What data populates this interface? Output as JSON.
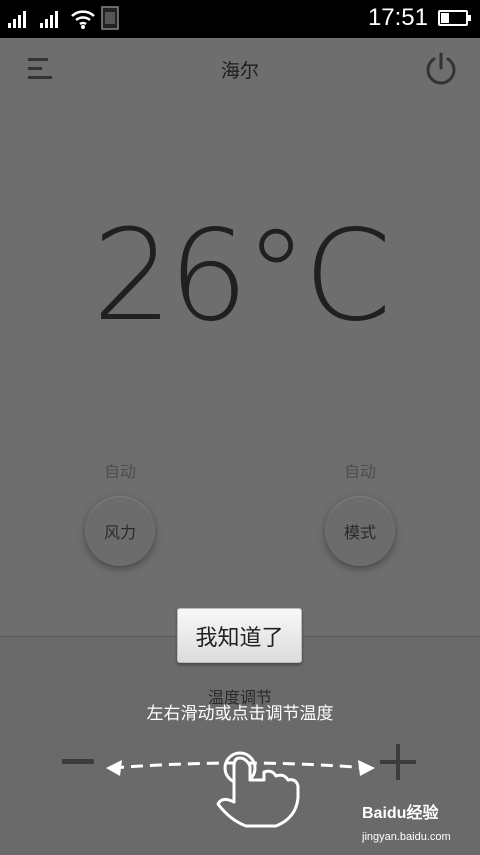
{
  "status_bar": {
    "time": "17:51",
    "battery_level": 0.35
  },
  "header": {
    "title": "海尔",
    "menu_icon": "menu-icon",
    "power_icon": "power-icon"
  },
  "main": {
    "temperature": "26°C",
    "fan": {
      "status": "自动",
      "label": "风力"
    },
    "mode": {
      "status": "自动",
      "label": "模式"
    }
  },
  "bottom_panel": {
    "title": "温度调节",
    "minus_icon": "minus-icon",
    "plus_icon": "plus-icon"
  },
  "overlay": {
    "dismiss_button": "我知道了",
    "hint_text": "左右滑动或点击调节温度",
    "gesture_icon": "swipe-hand-icon"
  },
  "watermark": {
    "brand": "Baidu经验",
    "url": "jingyan.baidu.com"
  },
  "colors": {
    "background": "#6e6e6e",
    "status_bar": "#000000",
    "text_dark": "#202020"
  }
}
